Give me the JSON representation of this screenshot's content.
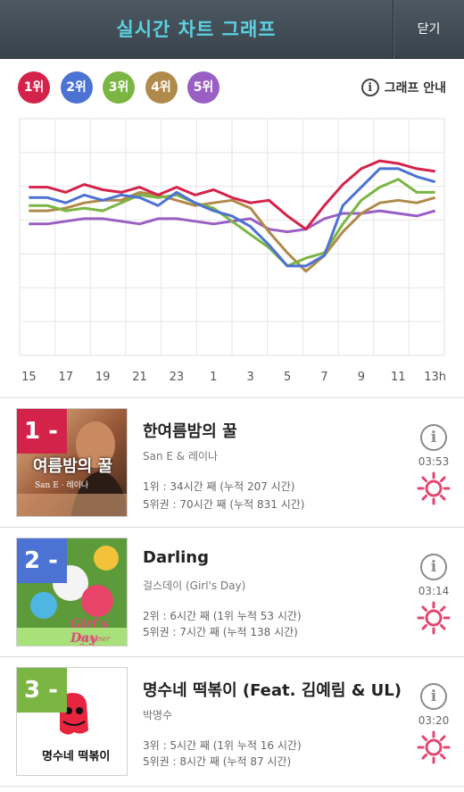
{
  "header": {
    "title": "실시간 차트 그래프",
    "close_label": "닫기"
  },
  "rank_buttons": [
    {
      "label": "1위",
      "color": "#d4234b"
    },
    {
      "label": "2위",
      "color": "#4c72d4"
    },
    {
      "label": "3위",
      "color": "#7bb543"
    },
    {
      "label": "4위",
      "color": "#b08a4a"
    },
    {
      "label": "5위",
      "color": "#9a5fc4"
    }
  ],
  "graph_guide": {
    "label": "그래프 안내",
    "icon": "info-icon"
  },
  "chart_data": {
    "type": "line",
    "x": [
      "15",
      "",
      "17",
      "",
      "19",
      "",
      "21",
      "",
      "23",
      "",
      "1",
      "",
      "3",
      "",
      "5",
      "",
      "7",
      "",
      "9",
      "",
      "11",
      "",
      "13h"
    ],
    "tick_labels": [
      "15",
      "17",
      "19",
      "21",
      "23",
      "1",
      "3",
      "5",
      "7",
      "9",
      "11",
      "13h"
    ],
    "y_inverted": true,
    "ylim": [
      1,
      10
    ],
    "grid": true,
    "series": [
      {
        "name": "1위",
        "color": "#d4234b",
        "values": [
          3.6,
          3.6,
          3.8,
          3.5,
          3.7,
          3.8,
          3.6,
          3.9,
          3.6,
          3.9,
          3.7,
          4.0,
          4.2,
          4.1,
          4.7,
          5.2,
          4.3,
          3.5,
          2.9,
          2.6,
          2.7,
          2.9,
          3.0
        ]
      },
      {
        "name": "2위",
        "color": "#4c72d4",
        "values": [
          4.0,
          4.0,
          4.2,
          3.9,
          4.1,
          3.9,
          4.0,
          4.3,
          3.8,
          4.2,
          4.5,
          4.7,
          5.1,
          5.8,
          6.6,
          6.6,
          6.2,
          4.3,
          3.6,
          2.9,
          2.9,
          3.2,
          3.4
        ]
      },
      {
        "name": "3위",
        "color": "#7bb543",
        "values": [
          4.3,
          4.3,
          4.5,
          4.4,
          4.5,
          4.2,
          3.9,
          4.0,
          3.9,
          4.2,
          4.4,
          4.9,
          5.4,
          5.9,
          6.6,
          6.3,
          6.1,
          5.0,
          4.1,
          3.6,
          3.3,
          3.8,
          3.8
        ]
      },
      {
        "name": "4위",
        "color": "#b08a4a",
        "values": [
          4.5,
          4.5,
          4.4,
          4.2,
          4.1,
          4.1,
          3.8,
          3.9,
          4.1,
          4.3,
          4.2,
          4.1,
          4.4,
          5.3,
          6.1,
          6.8,
          6.2,
          5.3,
          4.6,
          4.2,
          4.1,
          4.2,
          4.0
        ]
      },
      {
        "name": "5위",
        "color": "#9a5fc4",
        "values": [
          5.0,
          5.0,
          4.9,
          4.8,
          4.8,
          4.9,
          5.0,
          4.8,
          4.8,
          4.9,
          5.0,
          4.9,
          4.8,
          5.2,
          5.3,
          5.2,
          4.8,
          4.6,
          4.6,
          4.5,
          4.6,
          4.7,
          4.5
        ]
      }
    ]
  },
  "songs": [
    {
      "rank_label": "1 -",
      "rank_color": "#d4234b",
      "title": "한여름밤의 꿀",
      "artist": "San E & 레이나",
      "stat1": "1위 : 34시간 째 (누적 207 시간)",
      "stat2": "5위권 : 70시간 째 (누적 831 시간)",
      "duration": "03:53",
      "cover_text": "여름밤의 꿀",
      "cover_sub": "San E · 레이나"
    },
    {
      "rank_label": "2 -",
      "rank_color": "#4c72d4",
      "title": "Darling",
      "artist": "걸스데이 (Girl's Day)",
      "stat1": "2위 : 6시간 째 (1위 누적 53 시간)",
      "stat2": "5위권 : 7시간 째 (누적 138 시간)",
      "duration": "03:14",
      "cover_text": "Girl's Day",
      "cover_sub": "Summer Party"
    },
    {
      "rank_label": "3 -",
      "rank_color": "#7bb543",
      "title": "명수네 떡볶이 (Feat. 김예림 & UL)",
      "artist": "박명수",
      "stat1": "3위 : 5시간 째 (1위 누적 16 시간)",
      "stat2": "5위권 : 8시간 째 (누적 87 시간)",
      "duration": "03:20",
      "cover_text": "명수네 떡볶이"
    }
  ]
}
